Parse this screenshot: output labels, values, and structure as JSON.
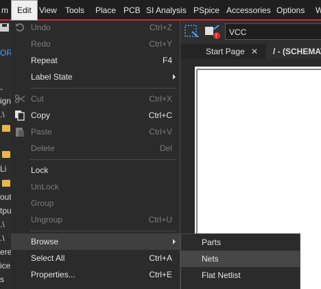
{
  "menubar": {
    "items": [
      {
        "label": "m"
      },
      {
        "label": "Edit"
      },
      {
        "label": "View"
      },
      {
        "label": "Tools"
      },
      {
        "label": "Place"
      },
      {
        "label": "PCB"
      },
      {
        "label": "SI Analysis"
      },
      {
        "label": "PSpice"
      },
      {
        "label": "Accessories"
      },
      {
        "label": "Options"
      },
      {
        "label": "W"
      }
    ],
    "accent_color": "#d2233a"
  },
  "left_strip": {
    "texts": [
      "ORI",
      "-",
      "ign",
      ".\\",
      "Li",
      "out",
      "tpu",
      ".\\",
      ".\\",
      "ere",
      "ice",
      "s"
    ]
  },
  "edit_menu": {
    "items": [
      {
        "label": "Undo",
        "shortcut": "Ctrl+Z",
        "enabled": false,
        "icon": "undo-icon"
      },
      {
        "label": "Redo",
        "shortcut": "Ctrl+Y",
        "enabled": false
      },
      {
        "label": "Repeat",
        "shortcut": "F4",
        "enabled": true
      },
      {
        "label": "Label State",
        "shortcut": "",
        "enabled": true,
        "submenu": true
      },
      {
        "label": "Cut",
        "shortcut": "Ctrl+X",
        "enabled": false,
        "icon": "scissors-icon"
      },
      {
        "label": "Copy",
        "shortcut": "Ctrl+C",
        "enabled": true,
        "icon": "copy-icon"
      },
      {
        "label": "Paste",
        "shortcut": "Ctrl+V",
        "enabled": false,
        "icon": "paste-icon"
      },
      {
        "label": "Delete",
        "shortcut": "Del",
        "enabled": false
      },
      {
        "label": "Lock",
        "shortcut": "",
        "enabled": true
      },
      {
        "label": "UnLock",
        "shortcut": "",
        "enabled": false
      },
      {
        "label": "Group",
        "shortcut": "",
        "enabled": false
      },
      {
        "label": "Ungroup",
        "shortcut": "Ctrl+U",
        "enabled": false
      },
      {
        "label": "Browse",
        "shortcut": "",
        "enabled": true,
        "submenu": true,
        "highlighted": true
      },
      {
        "label": "Select All",
        "shortcut": "Ctrl+A",
        "enabled": true
      },
      {
        "label": "Properties...",
        "shortcut": "Ctrl+E",
        "enabled": true
      }
    ]
  },
  "browse_submenu": {
    "items": [
      {
        "label": "Parts"
      },
      {
        "label": "Nets",
        "highlighted": true
      },
      {
        "label": "Flat Netlist"
      }
    ]
  },
  "toolbar": {
    "net_combo_value": "VCC"
  },
  "tabs": [
    {
      "label": "Start Page",
      "closable": true
    },
    {
      "label": "/ - (SCHEMAT",
      "active": true
    }
  ]
}
